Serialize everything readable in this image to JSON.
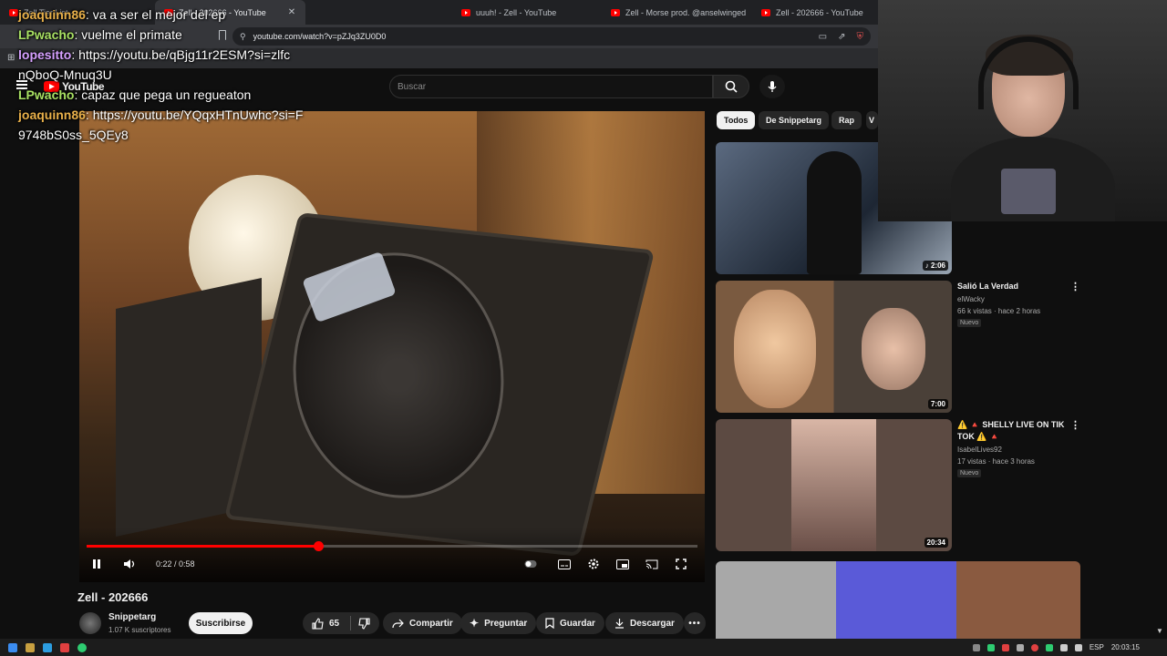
{
  "browser": {
    "tabs": [
      {
        "label": "Zell Tier List ·",
        "active": false
      },
      {
        "label": "Zell - 202666 - YouTube",
        "active": true
      },
      {
        "label": "uuuh! - Zell - YouTube",
        "active": false
      },
      {
        "label": "Zell - Morse prod. @anselwinged [A",
        "active": false
      },
      {
        "label": "Zell - 202666 - YouTube",
        "active": false
      }
    ],
    "close_glyph": "✕",
    "url": "youtube.com/watch?v=pZJq3ZU0D0"
  },
  "youtube": {
    "logo_text": "YouTube",
    "search_placeholder": "Buscar",
    "chips": [
      "Todos",
      "De Snippetarg",
      "Rap",
      "V"
    ],
    "video": {
      "title": "Zell - 202666",
      "time_current": "0:22",
      "time_total": "0:58",
      "time_display": "0:22 / 0:58",
      "progress_fraction": 0.379
    },
    "channel": {
      "name": "Snippetarg",
      "subscribers": "1.07 K suscriptores",
      "subscribe_label": "Suscribirse"
    },
    "actions": {
      "likes": "65",
      "share": "Compartir",
      "ask": "Preguntar",
      "save": "Guardar",
      "download": "Descargar"
    },
    "recommendations": [
      {
        "title": "",
        "channel": "",
        "meta": "",
        "badge": "",
        "duration": "♪ 2:06"
      },
      {
        "title": "Salió La Verdad",
        "channel": "elWacky",
        "meta": "66 k vistas · hace 2 horas",
        "badge": "Nuevo",
        "duration": "7:00"
      },
      {
        "title": "⚠️ 🔺 SHELLY LIVE ON TIK TOK ⚠️ 🔺",
        "channel": "IsabelLives92",
        "meta": "17 vistas · hace 3 horas",
        "badge": "Nuevo",
        "duration": "20:34"
      }
    ]
  },
  "chat": [
    {
      "user": "joaquinn86",
      "message": "va a ser el mejor del ep",
      "color": "#e8b04a"
    },
    {
      "user": "LPwacho",
      "message": "vuelme el primate",
      "color": "#a8e063"
    },
    {
      "user": "lopesitto",
      "message": "https://youtu.be/qBjg11r2ESM?si=zlfcnQboQ-Mnuq3U",
      "color": "#d6a0ff"
    },
    {
      "user": "LPwacho",
      "message": "capaz que pega un regueaton",
      "color": "#a8e063"
    },
    {
      "user": "joaquinn86",
      "message": "https://youtu.be/YQqxHTnUwhc?si=F9748bS0ss_5QEy8",
      "color": "#e8b04a"
    }
  ],
  "taskbar": {
    "lang": "ESP",
    "time": "20:03:15"
  },
  "colors": {
    "accent": "#ff0000",
    "bg": "#0f0f0f",
    "pill": "#272727"
  }
}
